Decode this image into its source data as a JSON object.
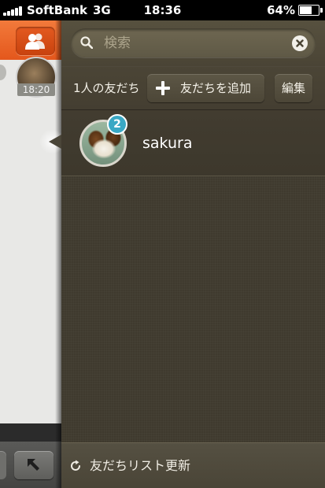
{
  "status_bar": {
    "carrier": "SoftBank",
    "network": "3G",
    "time": "18:36",
    "battery_percent": "64%",
    "battery_level": 0.64
  },
  "background_chat": {
    "timestamp": "18:20"
  },
  "search": {
    "placeholder": "検索",
    "value": ""
  },
  "toolbar": {
    "friend_count": "1人の友だち",
    "add_friend_label": "友だちを追加",
    "edit_label": "編集"
  },
  "friends": [
    {
      "name": "sakura",
      "badge": "2"
    }
  ],
  "bottom_bar": {
    "refresh_label": "友だちリスト更新"
  },
  "colors": {
    "accent_orange": "#e4571c",
    "panel_background": "#3f3a2e",
    "badge_blue": "#3aa8c4"
  },
  "icons": {
    "friends_tab": "people-icon",
    "search": "search-icon",
    "clear": "close-icon",
    "add": "plus-icon",
    "refresh": "refresh-icon",
    "compose": "arrow-up-left-icon"
  }
}
